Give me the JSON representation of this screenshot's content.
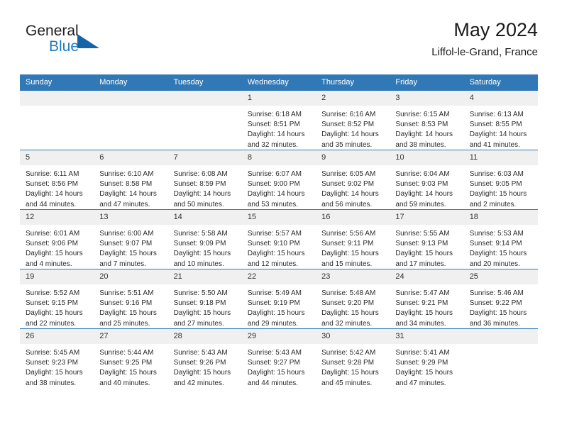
{
  "brand": {
    "name_part1": "General",
    "name_part2": "Blue",
    "logo_icon": "blue-triangle-icon",
    "accent_color": "#1f7bc1",
    "header_color": "#3179b6"
  },
  "header": {
    "title": "May 2024",
    "subtitle": "Liffol-le-Grand, France"
  },
  "calendar": {
    "weekday_headers": [
      "Sunday",
      "Monday",
      "Tuesday",
      "Wednesday",
      "Thursday",
      "Friday",
      "Saturday"
    ],
    "weeks": [
      [
        {
          "day": "",
          "blank": true
        },
        {
          "day": "",
          "blank": true
        },
        {
          "day": "",
          "blank": true
        },
        {
          "day": "1",
          "sunrise": "Sunrise: 6:18 AM",
          "sunset": "Sunset: 8:51 PM",
          "daylight": "Daylight: 14 hours and 32 minutes."
        },
        {
          "day": "2",
          "sunrise": "Sunrise: 6:16 AM",
          "sunset": "Sunset: 8:52 PM",
          "daylight": "Daylight: 14 hours and 35 minutes."
        },
        {
          "day": "3",
          "sunrise": "Sunrise: 6:15 AM",
          "sunset": "Sunset: 8:53 PM",
          "daylight": "Daylight: 14 hours and 38 minutes."
        },
        {
          "day": "4",
          "sunrise": "Sunrise: 6:13 AM",
          "sunset": "Sunset: 8:55 PM",
          "daylight": "Daylight: 14 hours and 41 minutes."
        }
      ],
      [
        {
          "day": "5",
          "sunrise": "Sunrise: 6:11 AM",
          "sunset": "Sunset: 8:56 PM",
          "daylight": "Daylight: 14 hours and 44 minutes."
        },
        {
          "day": "6",
          "sunrise": "Sunrise: 6:10 AM",
          "sunset": "Sunset: 8:58 PM",
          "daylight": "Daylight: 14 hours and 47 minutes."
        },
        {
          "day": "7",
          "sunrise": "Sunrise: 6:08 AM",
          "sunset": "Sunset: 8:59 PM",
          "daylight": "Daylight: 14 hours and 50 minutes."
        },
        {
          "day": "8",
          "sunrise": "Sunrise: 6:07 AM",
          "sunset": "Sunset: 9:00 PM",
          "daylight": "Daylight: 14 hours and 53 minutes."
        },
        {
          "day": "9",
          "sunrise": "Sunrise: 6:05 AM",
          "sunset": "Sunset: 9:02 PM",
          "daylight": "Daylight: 14 hours and 56 minutes."
        },
        {
          "day": "10",
          "sunrise": "Sunrise: 6:04 AM",
          "sunset": "Sunset: 9:03 PM",
          "daylight": "Daylight: 14 hours and 59 minutes."
        },
        {
          "day": "11",
          "sunrise": "Sunrise: 6:03 AM",
          "sunset": "Sunset: 9:05 PM",
          "daylight": "Daylight: 15 hours and 2 minutes."
        }
      ],
      [
        {
          "day": "12",
          "sunrise": "Sunrise: 6:01 AM",
          "sunset": "Sunset: 9:06 PM",
          "daylight": "Daylight: 15 hours and 4 minutes."
        },
        {
          "day": "13",
          "sunrise": "Sunrise: 6:00 AM",
          "sunset": "Sunset: 9:07 PM",
          "daylight": "Daylight: 15 hours and 7 minutes."
        },
        {
          "day": "14",
          "sunrise": "Sunrise: 5:58 AM",
          "sunset": "Sunset: 9:09 PM",
          "daylight": "Daylight: 15 hours and 10 minutes."
        },
        {
          "day": "15",
          "sunrise": "Sunrise: 5:57 AM",
          "sunset": "Sunset: 9:10 PM",
          "daylight": "Daylight: 15 hours and 12 minutes."
        },
        {
          "day": "16",
          "sunrise": "Sunrise: 5:56 AM",
          "sunset": "Sunset: 9:11 PM",
          "daylight": "Daylight: 15 hours and 15 minutes."
        },
        {
          "day": "17",
          "sunrise": "Sunrise: 5:55 AM",
          "sunset": "Sunset: 9:13 PM",
          "daylight": "Daylight: 15 hours and 17 minutes."
        },
        {
          "day": "18",
          "sunrise": "Sunrise: 5:53 AM",
          "sunset": "Sunset: 9:14 PM",
          "daylight": "Daylight: 15 hours and 20 minutes."
        }
      ],
      [
        {
          "day": "19",
          "sunrise": "Sunrise: 5:52 AM",
          "sunset": "Sunset: 9:15 PM",
          "daylight": "Daylight: 15 hours and 22 minutes."
        },
        {
          "day": "20",
          "sunrise": "Sunrise: 5:51 AM",
          "sunset": "Sunset: 9:16 PM",
          "daylight": "Daylight: 15 hours and 25 minutes."
        },
        {
          "day": "21",
          "sunrise": "Sunrise: 5:50 AM",
          "sunset": "Sunset: 9:18 PM",
          "daylight": "Daylight: 15 hours and 27 minutes."
        },
        {
          "day": "22",
          "sunrise": "Sunrise: 5:49 AM",
          "sunset": "Sunset: 9:19 PM",
          "daylight": "Daylight: 15 hours and 29 minutes."
        },
        {
          "day": "23",
          "sunrise": "Sunrise: 5:48 AM",
          "sunset": "Sunset: 9:20 PM",
          "daylight": "Daylight: 15 hours and 32 minutes."
        },
        {
          "day": "24",
          "sunrise": "Sunrise: 5:47 AM",
          "sunset": "Sunset: 9:21 PM",
          "daylight": "Daylight: 15 hours and 34 minutes."
        },
        {
          "day": "25",
          "sunrise": "Sunrise: 5:46 AM",
          "sunset": "Sunset: 9:22 PM",
          "daylight": "Daylight: 15 hours and 36 minutes."
        }
      ],
      [
        {
          "day": "26",
          "sunrise": "Sunrise: 5:45 AM",
          "sunset": "Sunset: 9:23 PM",
          "daylight": "Daylight: 15 hours and 38 minutes."
        },
        {
          "day": "27",
          "sunrise": "Sunrise: 5:44 AM",
          "sunset": "Sunset: 9:25 PM",
          "daylight": "Daylight: 15 hours and 40 minutes."
        },
        {
          "day": "28",
          "sunrise": "Sunrise: 5:43 AM",
          "sunset": "Sunset: 9:26 PM",
          "daylight": "Daylight: 15 hours and 42 minutes."
        },
        {
          "day": "29",
          "sunrise": "Sunrise: 5:43 AM",
          "sunset": "Sunset: 9:27 PM",
          "daylight": "Daylight: 15 hours and 44 minutes."
        },
        {
          "day": "30",
          "sunrise": "Sunrise: 5:42 AM",
          "sunset": "Sunset: 9:28 PM",
          "daylight": "Daylight: 15 hours and 45 minutes."
        },
        {
          "day": "31",
          "sunrise": "Sunrise: 5:41 AM",
          "sunset": "Sunset: 9:29 PM",
          "daylight": "Daylight: 15 hours and 47 minutes."
        },
        {
          "day": "",
          "blank": true
        }
      ]
    ]
  }
}
